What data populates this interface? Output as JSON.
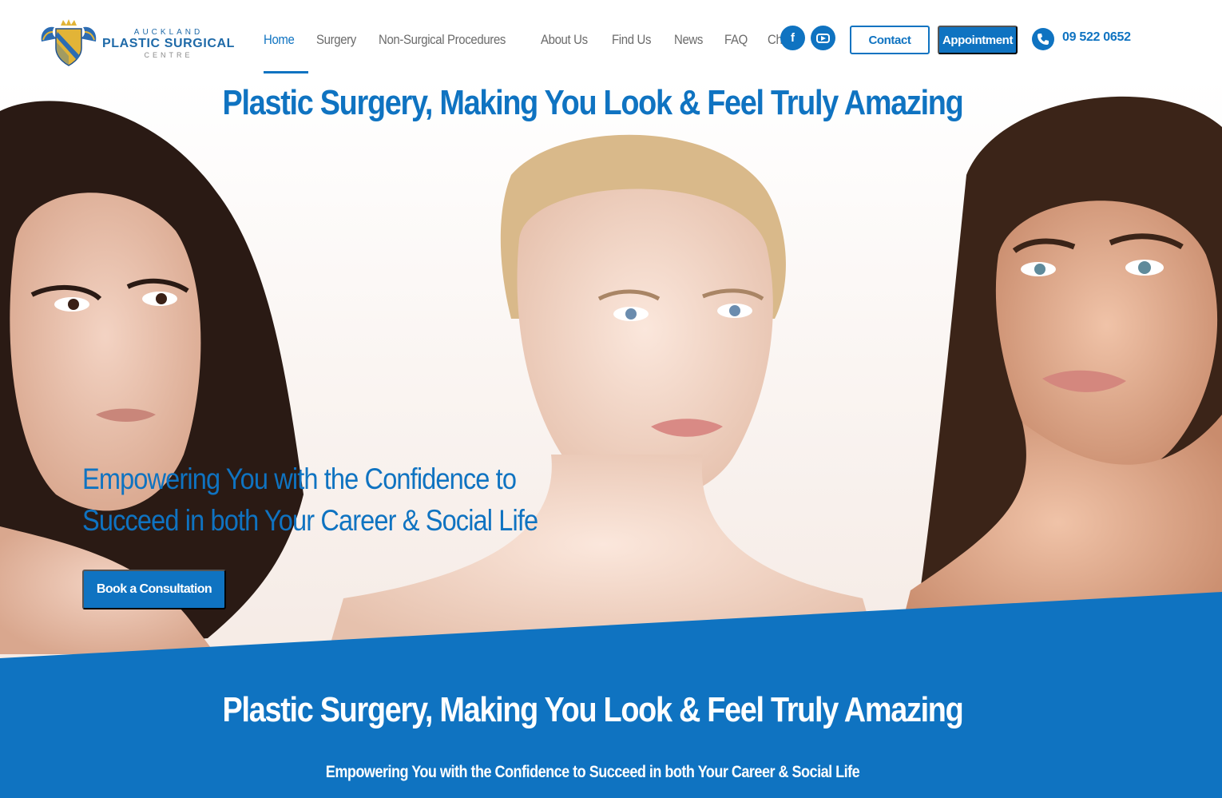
{
  "brand": {
    "top_line": "AUCKLAND",
    "main_line": "PLASTIC SURGICAL",
    "bottom_line": "CENTRE"
  },
  "nav": {
    "items": [
      {
        "label": "Home",
        "active": true
      },
      {
        "label": "Surgery",
        "active": false
      },
      {
        "label": "Non-Surgical Procedures",
        "active": false
      },
      {
        "label": "About Us",
        "active": false
      },
      {
        "label": "Find Us",
        "active": false
      },
      {
        "label": "News",
        "active": false
      },
      {
        "label": "FAQ",
        "active": false
      },
      {
        "label": "Charity",
        "active": false
      }
    ]
  },
  "social": {
    "facebook_glyph": "f",
    "facebook_icon": "facebook-icon",
    "youtube_icon": "youtube-icon"
  },
  "header_buttons": {
    "contact_label": "Contact",
    "appointment_label": "Appointment"
  },
  "phone": {
    "icon": "phone-icon",
    "number": "09 522 0652"
  },
  "hero": {
    "title": "Plastic Surgery, Making You Look & Feel Truly Amazing",
    "subtitle": "Empowering You with the Confidence to Succeed in both Your Career & Social Life",
    "cta_label": "Book a Consultation"
  },
  "band": {
    "title": "Plastic Surgery, Making You Look & Feel Truly Amazing",
    "subtitle": "Empowering You with the Confidence to Succeed in both Your Career & Social Life"
  },
  "colors": {
    "brand_blue": "#0f73c1",
    "nav_text": "#6b6b6b",
    "white": "#ffffff"
  }
}
